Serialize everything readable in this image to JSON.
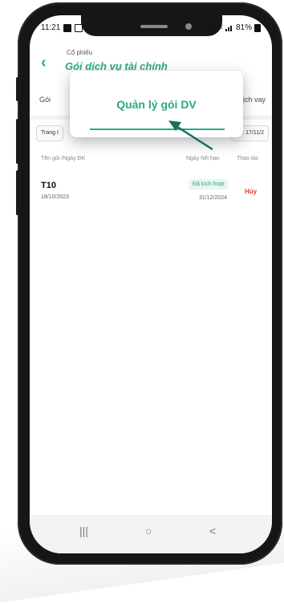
{
  "status_bar": {
    "time": "11:21",
    "battery": "81%",
    "network": "VoLTE"
  },
  "header": {
    "subtitle": "Cổ phiếu",
    "title": "Gói dịch vụ tài chính"
  },
  "tabs": [
    "Gói",
    "ịch vay"
  ],
  "filters": [
    {
      "label": "Trang t"
    },
    {
      "label": "ạn: 17/11/2"
    }
  ],
  "table": {
    "headers": {
      "name_date": "Tên gói /Ngày ĐK",
      "expiry": "Ngày hết hạn",
      "actions": "Thao tác"
    },
    "rows": [
      {
        "name": "T10",
        "reg_date": "18/10/2023",
        "status": "Đã kích hoạt",
        "expiry": "31/12/2024",
        "action": "Hủy"
      }
    ]
  },
  "callout": {
    "label": "Quản lý gói DV"
  },
  "navbar": {
    "recent": "|||",
    "home": "○",
    "back": "<"
  },
  "colors": {
    "accent": "#2aa886",
    "danger": "#e53935"
  },
  "icons": [
    "image-icon",
    "message-icon",
    "signal-icon",
    "battery-icon",
    "back-arrow-icon",
    "pointer-arrow-icon"
  ]
}
